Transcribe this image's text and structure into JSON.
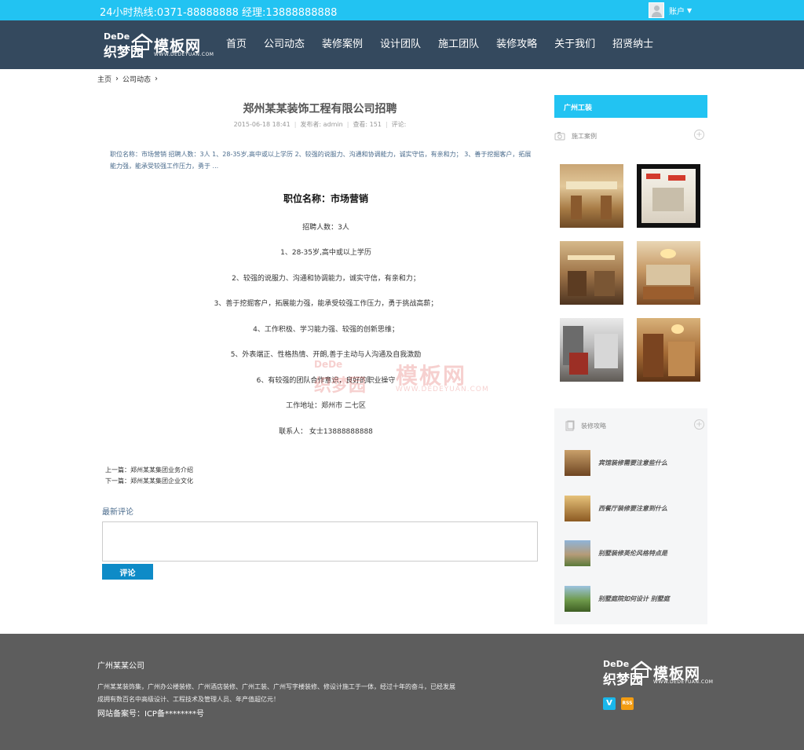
{
  "topbar": {
    "hotline": "24小时热线:0371-88888888  经理:13888888888",
    "account_label": "账户"
  },
  "logo": {
    "dede": "DeDe",
    "cn1": "织梦园",
    "cn2": "模板网",
    "domain": "WWW.DEDEYUAN.COM"
  },
  "nav": [
    "首页",
    "公司动态",
    "装修案例",
    "设计团队",
    "施工团队",
    "装修攻略",
    "关于我们",
    "招贤纳士"
  ],
  "breadcrumb": [
    "主页",
    "公司动态"
  ],
  "article": {
    "title": "郑州某某装饰工程有限公司招聘",
    "date": "2015-06-18 18:41",
    "author": "发布者: admin",
    "views": "查看: 151",
    "comments": "评论:",
    "summary": "职位名称：市场营销 招聘人数：3人 1、28-35岁,高中或以上学历 2、较强的说服力、沟通和协调能力，诚实守信，有亲和力； 3、善于挖掘客户，拓展能力强，能承受较强工作压力，勇于 ...",
    "heading": "职位名称：市场营销",
    "lines": [
      "招聘人数：3人",
      "1、28-35岁,高中或以上学历",
      "2、较强的说服力、沟通和协调能力，诚实守信，有亲和力；",
      "3、善于挖掘客户，拓展能力强，能承受较强工作压力，勇于挑战高薪；",
      "4、工作积极、学习能力强、较强的创新思维；",
      "5、外表端正、性格热情、开朗,善于主动与人沟通及自我激励",
      "6、有较强的团队合作意识，良好的职业操守",
      "工作地址：郑州市 二七区",
      "联系人： 女士13888888888"
    ],
    "prev": "上一篇：郑州某某集团业务介绍",
    "next": "下一篇：郑州某某集团企业文化"
  },
  "watermark": {
    "w1": "DeDe",
    "w2": "织梦园",
    "w3": "模板网",
    "w4": "WWW.DEDEYUAN.COM"
  },
  "comments": {
    "title": "最新评论",
    "submit": "评论"
  },
  "sidebar": {
    "banner": "广州工装",
    "cases_title": "施工案例",
    "guides_title": "装修攻略",
    "guides": [
      "宾馆装修需要注意些什么",
      "西餐厅装修要注意到什么",
      "别墅装修英伦风格特点是",
      "别墅庭院如何设计 别墅庭"
    ]
  },
  "footer": {
    "company": "广州某某公司",
    "desc": "广州某某装饰集，广州办公楼装修、广州酒店装修、广州工装、广州写字楼装修、修设计施工于一体，经过十年的奋斗，已经发展成拥有数百名中高级设计、工程技术及管理人员、年产值超亿元！",
    "icp": "网站备案号：ICP备********号",
    "social": [
      "V",
      "RSS"
    ]
  },
  "colors": {
    "accent": "#22c3f2",
    "header": "#34495e",
    "button": "#0e8bc7",
    "footer": "#5d5d5d"
  }
}
